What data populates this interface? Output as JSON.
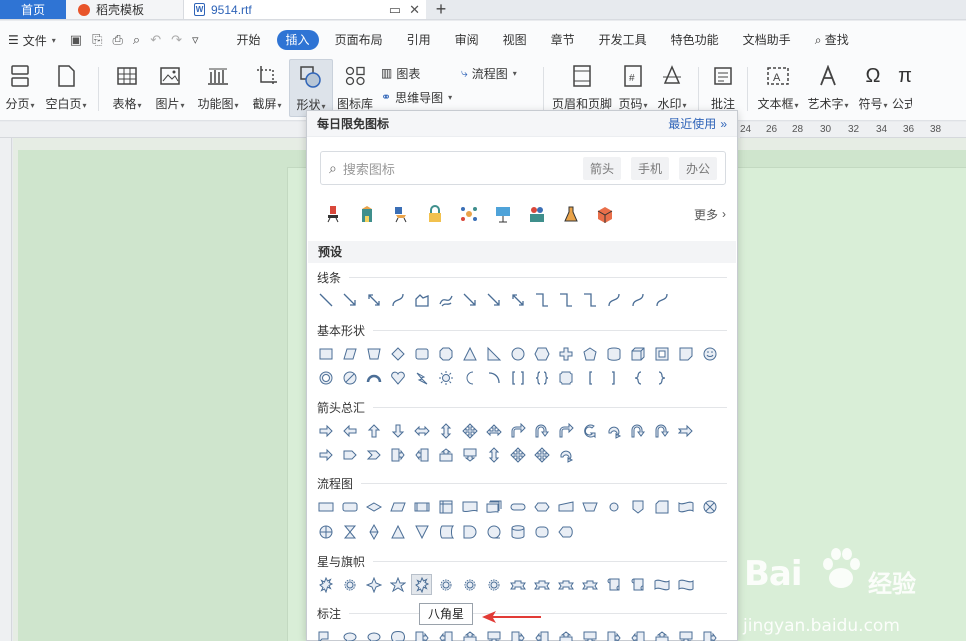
{
  "tabs": {
    "home": "首页",
    "templates": "稻壳模板",
    "file": "9514.rtf",
    "new_tab": "+"
  },
  "menubar": {
    "file_menu": "文件",
    "tabs": [
      "开始",
      "插入",
      "页面布局",
      "引用",
      "审阅",
      "视图",
      "章节",
      "开发工具",
      "特色功能",
      "文档助手"
    ],
    "active_tab": "插入",
    "search": "查找"
  },
  "ribbon": {
    "page_break": "分页",
    "blank_page": "空白页",
    "table": "表格",
    "picture": "图片",
    "function_chart": "功能图",
    "screenshot": "截屏",
    "shapes": "形状",
    "icon_library": "图标库",
    "chart": "图表",
    "mind_map": "思维导图",
    "flowchart": "流程图",
    "header_footer": "页眉和页脚",
    "page_number": "页码",
    "watermark": "水印",
    "comment": "批注",
    "textbox": "文本框",
    "wordart": "艺术字",
    "symbol": "符号",
    "formula": "公式"
  },
  "ruler": {
    "ticks": [
      "24",
      "26",
      "28",
      "30",
      "32",
      "34",
      "36",
      "38"
    ]
  },
  "panel": {
    "title": "每日限免图标",
    "recent": "最近使用",
    "search_placeholder": "搜索图标",
    "chips": [
      "箭头",
      "手机",
      "办公"
    ],
    "more": "更多",
    "preset": "预设",
    "categories": {
      "lines": "线条",
      "basic": "基本形状",
      "arrows": "箭头总汇",
      "flowchart": "流程图",
      "stars": "星与旗帜",
      "callouts": "标注"
    },
    "tooltip": "八角星"
  },
  "watermark": {
    "brand": "Bai",
    "cn": "经验",
    "url": "jingyan.baidu.com"
  },
  "colors": {
    "accent": "#2f74d4",
    "page_green": "#d9eed7",
    "arrow_red": "#e23b36"
  }
}
